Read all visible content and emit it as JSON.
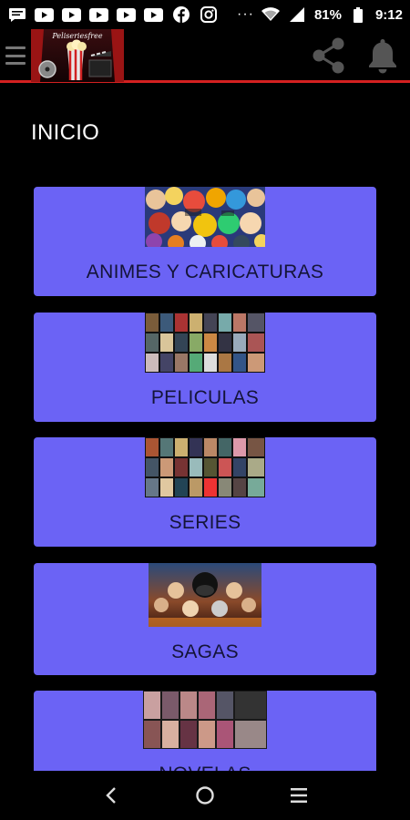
{
  "status_bar": {
    "battery": "81%",
    "time": "9:12",
    "overflow": "···",
    "notification_icons": [
      "message-icon",
      "youtube-icon",
      "youtube-icon",
      "youtube-icon",
      "youtube-icon",
      "youtube-icon",
      "facebook-icon",
      "instagram-icon"
    ]
  },
  "header": {
    "logo_text": "Peliseriesfree"
  },
  "main": {
    "title": "INICIO",
    "categories": [
      {
        "label": "ANIMES Y CARICATURAS"
      },
      {
        "label": "PELICULAS"
      },
      {
        "label": "SERIES"
      },
      {
        "label": "SAGAS"
      },
      {
        "label": "NOVELAS"
      }
    ]
  },
  "colors": {
    "card_bg": "#6b63f5",
    "accent_line": "#d32020",
    "background": "#000000"
  }
}
